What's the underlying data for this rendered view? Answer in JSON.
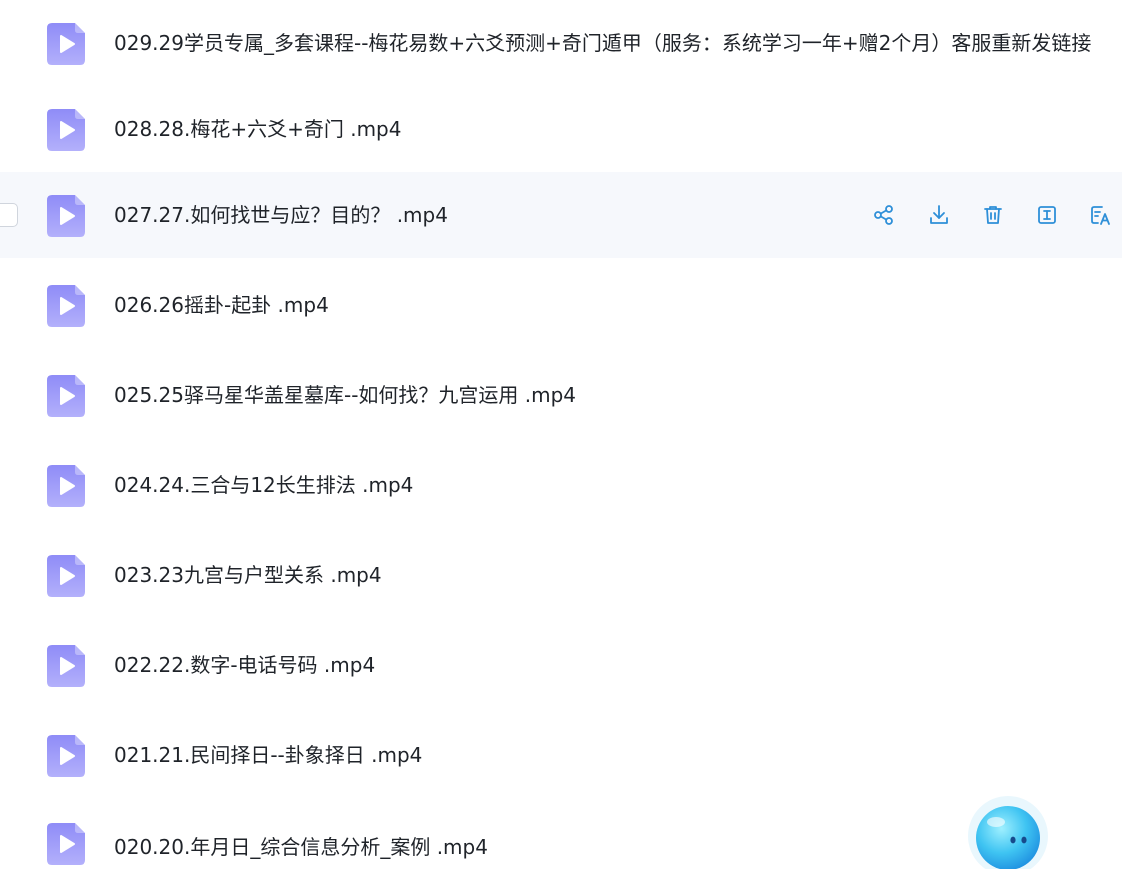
{
  "files": [
    {
      "name": "029.29学员专属_多套课程--梅花易数+六爻预测+奇门遁甲（服务：系统学习一年+赠2个月）客服重新发链接"
    },
    {
      "name": "028.28.梅花+六爻+奇门 .mp4"
    },
    {
      "name": "027.27.如何找世与应？目的？ .mp4"
    },
    {
      "name": "026.26摇卦-起卦 .mp4"
    },
    {
      "name": "025.25驿马星华盖星墓库--如何找？九宫运用 .mp4"
    },
    {
      "name": "024.24.三合与12长生排法 .mp4"
    },
    {
      "name": "023.23九宫与户型关系 .mp4"
    },
    {
      "name": "022.22.数字-电话号码 .mp4"
    },
    {
      "name": "021.21.民间择日--卦象择日 .mp4"
    },
    {
      "name": "020.20.年月日_综合信息分析_案例 .mp4"
    }
  ],
  "hovered_row_index": 2,
  "row_actions": [
    "share-icon",
    "download-icon",
    "delete-icon",
    "rename-icon",
    "ai-translate-icon"
  ],
  "colors": {
    "icon_gradient_top": "#8f8cf7",
    "icon_gradient_bottom": "#b3b0fb",
    "action_icon": "#2e8fd8",
    "hover_background": "#f6f8fc",
    "text": "#1f2329"
  }
}
